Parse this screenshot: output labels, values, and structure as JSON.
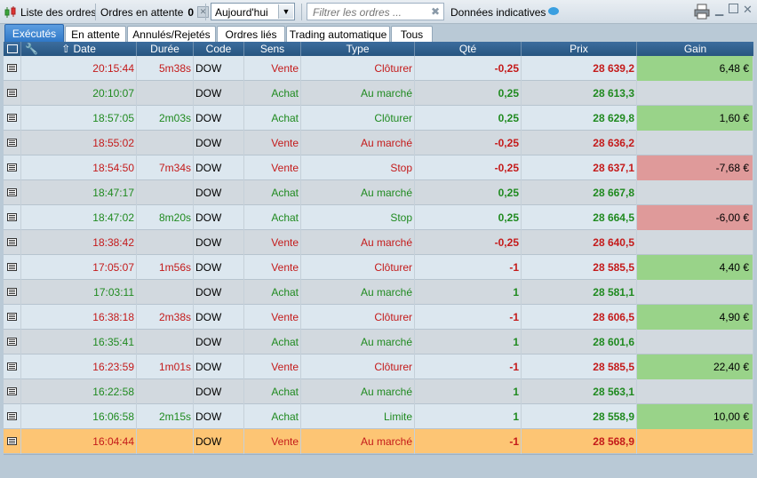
{
  "toolbar": {
    "title": "Liste des ordres",
    "pending_label": "Ordres en attente",
    "pending_count": "0",
    "period_value": "Aujourd'hui",
    "filter_placeholder": "Filtrer les ordres ...",
    "indicative_label": "Données indicatives"
  },
  "tabs": [
    {
      "label": "Exécutés",
      "active": true
    },
    {
      "label": "En attente",
      "active": false
    },
    {
      "label": "Annulés/Rejetés",
      "active": false
    },
    {
      "label": "Ordres liés",
      "active": false
    },
    {
      "label": "Trading automatique",
      "active": false
    },
    {
      "label": "Tous",
      "active": false
    }
  ],
  "columns": [
    "Date",
    "Durée",
    "Code",
    "Sens",
    "Type",
    "Qté",
    "Prix",
    "Gain"
  ],
  "rows": [
    {
      "date": "20:15:44",
      "duree": "5m38s",
      "code": "DOW",
      "sens": "Vente",
      "type": "Clôturer",
      "qte": "-0,25",
      "prix": "28 639,2",
      "gain": "6,48 €",
      "gain_state": "pos"
    },
    {
      "date": "20:10:07",
      "duree": "",
      "code": "DOW",
      "sens": "Achat",
      "type": "Au marché",
      "qte": "0,25",
      "prix": "28 613,3",
      "gain": "",
      "gain_state": ""
    },
    {
      "date": "18:57:05",
      "duree": "2m03s",
      "code": "DOW",
      "sens": "Achat",
      "type": "Clôturer",
      "qte": "0,25",
      "prix": "28 629,8",
      "gain": "1,60 €",
      "gain_state": "pos"
    },
    {
      "date": "18:55:02",
      "duree": "",
      "code": "DOW",
      "sens": "Vente",
      "type": "Au marché",
      "qte": "-0,25",
      "prix": "28 636,2",
      "gain": "",
      "gain_state": ""
    },
    {
      "date": "18:54:50",
      "duree": "7m34s",
      "code": "DOW",
      "sens": "Vente",
      "type": "Stop",
      "qte": "-0,25",
      "prix": "28 637,1",
      "gain": "-7,68 €",
      "gain_state": "neg"
    },
    {
      "date": "18:47:17",
      "duree": "",
      "code": "DOW",
      "sens": "Achat",
      "type": "Au marché",
      "qte": "0,25",
      "prix": "28 667,8",
      "gain": "",
      "gain_state": ""
    },
    {
      "date": "18:47:02",
      "duree": "8m20s",
      "code": "DOW",
      "sens": "Achat",
      "type": "Stop",
      "qte": "0,25",
      "prix": "28 664,5",
      "gain": "-6,00 €",
      "gain_state": "neg"
    },
    {
      "date": "18:38:42",
      "duree": "",
      "code": "DOW",
      "sens": "Vente",
      "type": "Au marché",
      "qte": "-0,25",
      "prix": "28 640,5",
      "gain": "",
      "gain_state": ""
    },
    {
      "date": "17:05:07",
      "duree": "1m56s",
      "code": "DOW",
      "sens": "Vente",
      "type": "Clôturer",
      "qte": "-1",
      "prix": "28 585,5",
      "gain": "4,40 €",
      "gain_state": "pos"
    },
    {
      "date": "17:03:11",
      "duree": "",
      "code": "DOW",
      "sens": "Achat",
      "type": "Au marché",
      "qte": "1",
      "prix": "28 581,1",
      "gain": "",
      "gain_state": ""
    },
    {
      "date": "16:38:18",
      "duree": "2m38s",
      "code": "DOW",
      "sens": "Vente",
      "type": "Clôturer",
      "qte": "-1",
      "prix": "28 606,5",
      "gain": "4,90 €",
      "gain_state": "pos"
    },
    {
      "date": "16:35:41",
      "duree": "",
      "code": "DOW",
      "sens": "Achat",
      "type": "Au marché",
      "qte": "1",
      "prix": "28 601,6",
      "gain": "",
      "gain_state": ""
    },
    {
      "date": "16:23:59",
      "duree": "1m01s",
      "code": "DOW",
      "sens": "Vente",
      "type": "Clôturer",
      "qte": "-1",
      "prix": "28 585,5",
      "gain": "22,40 €",
      "gain_state": "pos"
    },
    {
      "date": "16:22:58",
      "duree": "",
      "code": "DOW",
      "sens": "Achat",
      "type": "Au marché",
      "qte": "1",
      "prix": "28 563,1",
      "gain": "",
      "gain_state": ""
    },
    {
      "date": "16:06:58",
      "duree": "2m15s",
      "code": "DOW",
      "sens": "Achat",
      "type": "Limite",
      "qte": "1",
      "prix": "28 558,9",
      "gain": "10,00 €",
      "gain_state": "pos"
    },
    {
      "date": "16:04:44",
      "duree": "",
      "code": "DOW",
      "sens": "Vente",
      "type": "Au marché",
      "qte": "-1",
      "prix": "28 568,9",
      "gain": "",
      "gain_state": "",
      "selected": true
    }
  ],
  "colors": {
    "row_light": "#dce7ef",
    "row_dark": "#d2d9df",
    "row_selected": "#fdc574",
    "sell": "#c41a1a",
    "buy": "#1f8a1f",
    "gain_positive": "#99d389",
    "gain_negative": "#df9a9a",
    "tab_active": "#3b83d0"
  },
  "icons": [
    "candlestick-icon",
    "clear-icon",
    "chevron-down-icon",
    "clear-filter-icon",
    "chat-bubble-icon",
    "print-icon",
    "minimize-icon",
    "maximize-icon",
    "close-icon",
    "document-icon",
    "wrench-icon",
    "sort-arrow-icon"
  ]
}
